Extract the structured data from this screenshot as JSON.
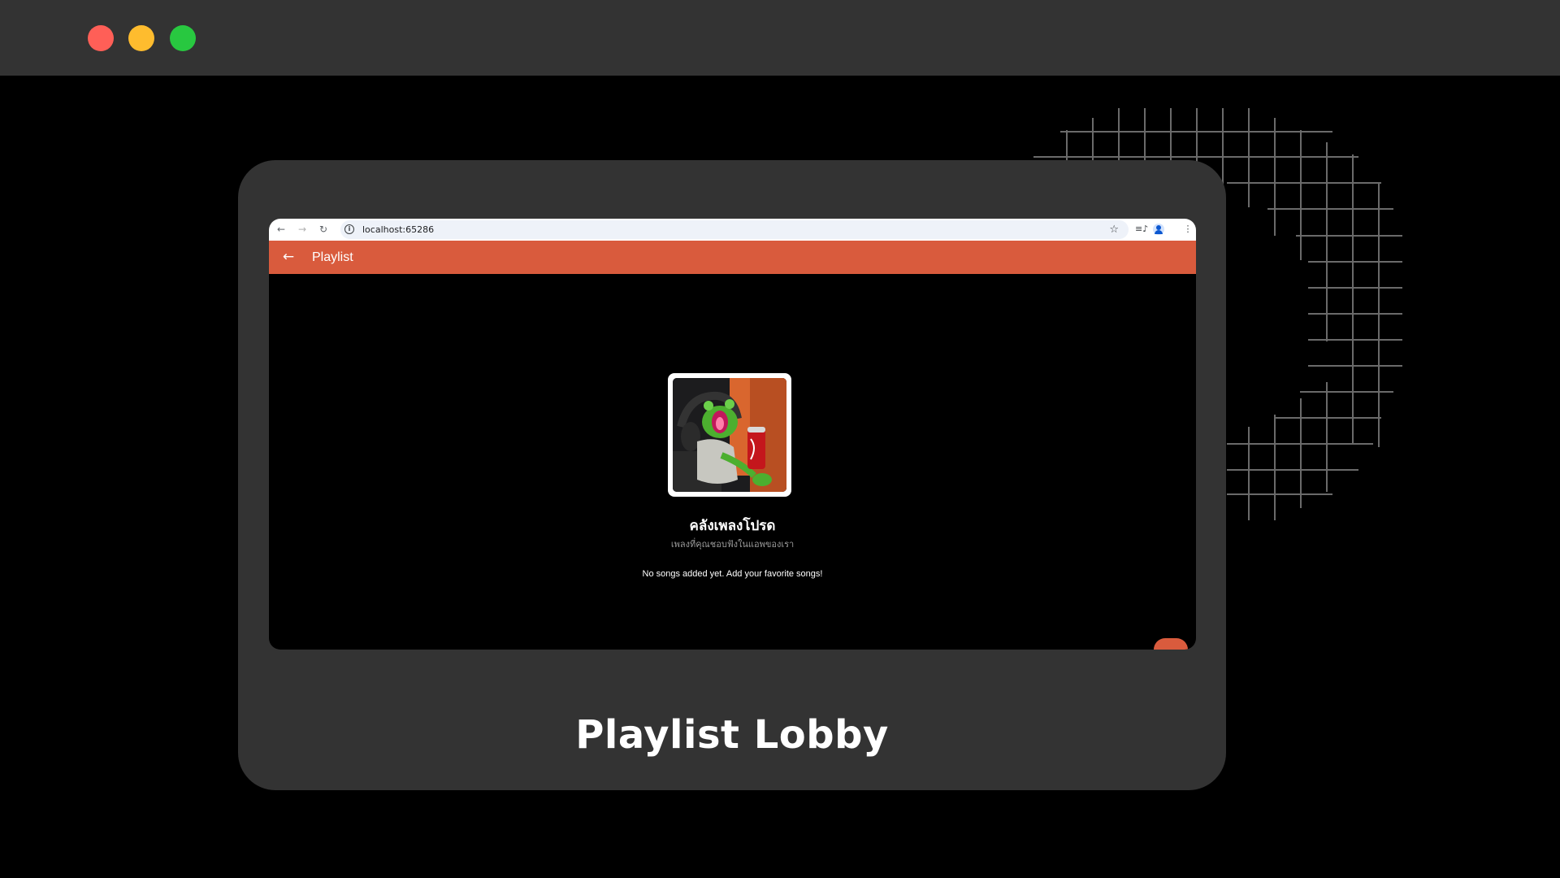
{
  "window": {
    "controls": [
      "close-dot",
      "minimize-dot",
      "maximize-dot"
    ]
  },
  "browser": {
    "url": "localhost:65286"
  },
  "appbar": {
    "title": "Playlist"
  },
  "playlist": {
    "name": "คลังเพลงโปรด",
    "subtitle": "เพลงที่คุณชอบฟังในแอพของเรา",
    "empty_message": "No songs added yet. Add your favorite songs!"
  },
  "caption": "Playlist Lobby",
  "colors": {
    "accent": "#d95b3d",
    "card": "#333333",
    "background": "#000000"
  }
}
